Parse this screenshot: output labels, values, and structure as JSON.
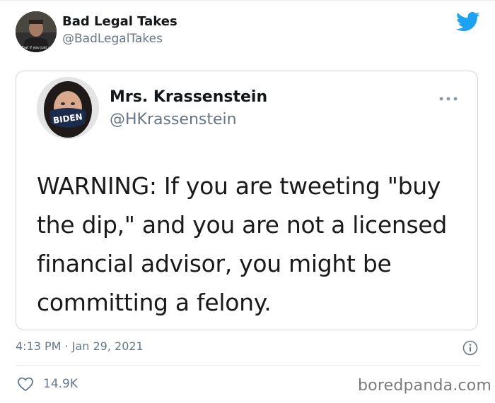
{
  "tweet": {
    "author_name": "Bad Legal Takes",
    "author_handle": "@BadLegalTakes",
    "avatar_caption": "What if you just sai",
    "timestamp": "4:13 PM",
    "separator": " · ",
    "date": "Jan 29, 2021",
    "likes": "14.9K"
  },
  "quoted_tweet": {
    "author_name": "Mrs. Krassenstein",
    "author_handle": "@HKrassenstein",
    "mask_text": "BIDEN",
    "text": "WARNING: If you are tweeting \"buy the dip,\" and you are not a licensed financial advisor, you might be committing a felony."
  },
  "watermark": "boredpanda.com",
  "icons": {
    "brand": "twitter-bird-icon",
    "more": "more-options-icon",
    "info": "info-icon",
    "like": "heart-icon"
  },
  "colors": {
    "twitter_blue": "#1da1f2",
    "secondary_text": "#657786",
    "primary_text": "#14171a",
    "mask_navy": "#1b2a4f"
  }
}
